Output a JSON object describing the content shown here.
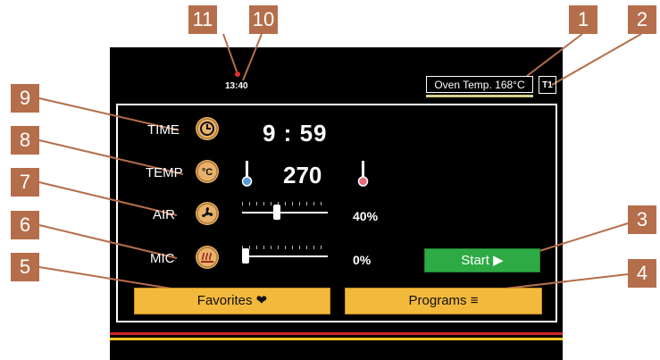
{
  "callouts": [
    "1",
    "2",
    "3",
    "4",
    "5",
    "6",
    "7",
    "8",
    "9",
    "10",
    "11"
  ],
  "status": {
    "clock": "13:40",
    "oven_temp_label": "Oven Temp.",
    "oven_temp_value": "168°C",
    "tray_label": "T1"
  },
  "rows": {
    "time": {
      "label": "TIME",
      "value": "9 : 59",
      "icon": "clock-icon"
    },
    "temp": {
      "label": "TEMP",
      "value": "270",
      "icon": "celsius-icon"
    },
    "air": {
      "label": "AIR",
      "value": "40%",
      "level": 0.4,
      "icon": "fan-icon"
    },
    "mic": {
      "label": "MIC",
      "value": "0%",
      "level": 0.0,
      "icon": "heating-icon"
    }
  },
  "buttons": {
    "start": "Start ▶",
    "favorites": "Favorites ❤",
    "programs": "Programs ≡"
  },
  "colors": {
    "screen": "#000000",
    "badge": "#b56e4b",
    "icon_fill": "#e9b26c",
    "start_green": "#2eaa44",
    "button_yellow": "#f2b93d",
    "stripe_red": "#d2232a",
    "stripe_yellow": "#f3c623",
    "thermo_cold": "#5a9bd5",
    "thermo_hot": "#e76a7a"
  }
}
